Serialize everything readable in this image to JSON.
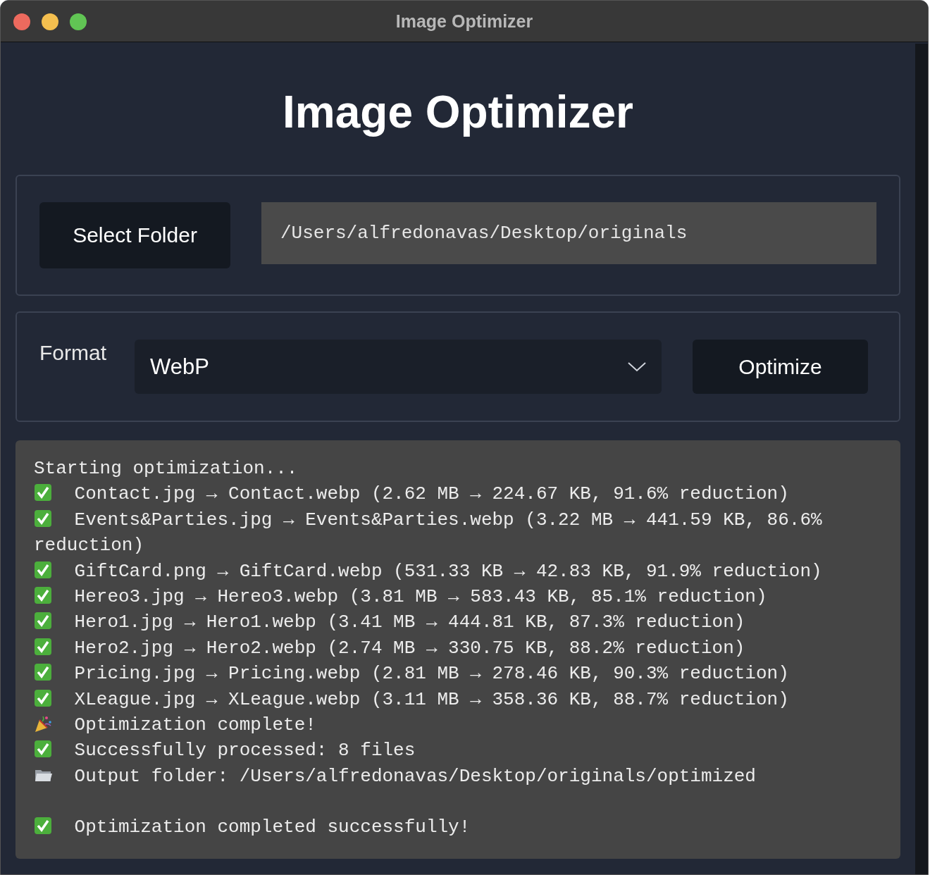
{
  "window": {
    "title": "Image Optimizer"
  },
  "heading": "Image Optimizer",
  "folder": {
    "button": "Select Folder",
    "path": "/Users/alfredonavas/Desktop/originals"
  },
  "format": {
    "label": "Format",
    "value": "WebP",
    "button": "Optimize"
  },
  "log": [
    {
      "kind": "plain",
      "text": "Starting optimization..."
    },
    {
      "kind": "check",
      "text": "Contact.jpg → Contact.webp (2.62 MB → 224.67 KB, 91.6% reduction)"
    },
    {
      "kind": "check",
      "text": "Events&Parties.jpg → Events&Parties.webp (3.22 MB → 441.59 KB, 86.6%"
    },
    {
      "kind": "plain",
      "text": "reduction)"
    },
    {
      "kind": "check",
      "text": "GiftCard.png → GiftCard.webp (531.33 KB → 42.83 KB, 91.9% reduction)"
    },
    {
      "kind": "check",
      "text": "Hereo3.jpg → Hereo3.webp (3.81 MB → 583.43 KB, 85.1% reduction)"
    },
    {
      "kind": "check",
      "text": "Hero1.jpg → Hero1.webp (3.41 MB → 444.81 KB, 87.3% reduction)"
    },
    {
      "kind": "check",
      "text": "Hero2.jpg → Hero2.webp (2.74 MB → 330.75 KB, 88.2% reduction)"
    },
    {
      "kind": "check",
      "text": "Pricing.jpg → Pricing.webp (2.81 MB → 278.46 KB, 90.3% reduction)"
    },
    {
      "kind": "check",
      "text": "XLeague.jpg → XLeague.webp (3.11 MB → 358.36 KB, 88.7% reduction)"
    },
    {
      "kind": "party",
      "text": "Optimization complete!"
    },
    {
      "kind": "check",
      "text": "Successfully processed: 8 files"
    },
    {
      "kind": "folder",
      "text": "Output folder: /Users/alfredonavas/Desktop/originals/optimized"
    },
    {
      "kind": "blank"
    },
    {
      "kind": "check",
      "text": "Optimization completed successfully!"
    }
  ]
}
